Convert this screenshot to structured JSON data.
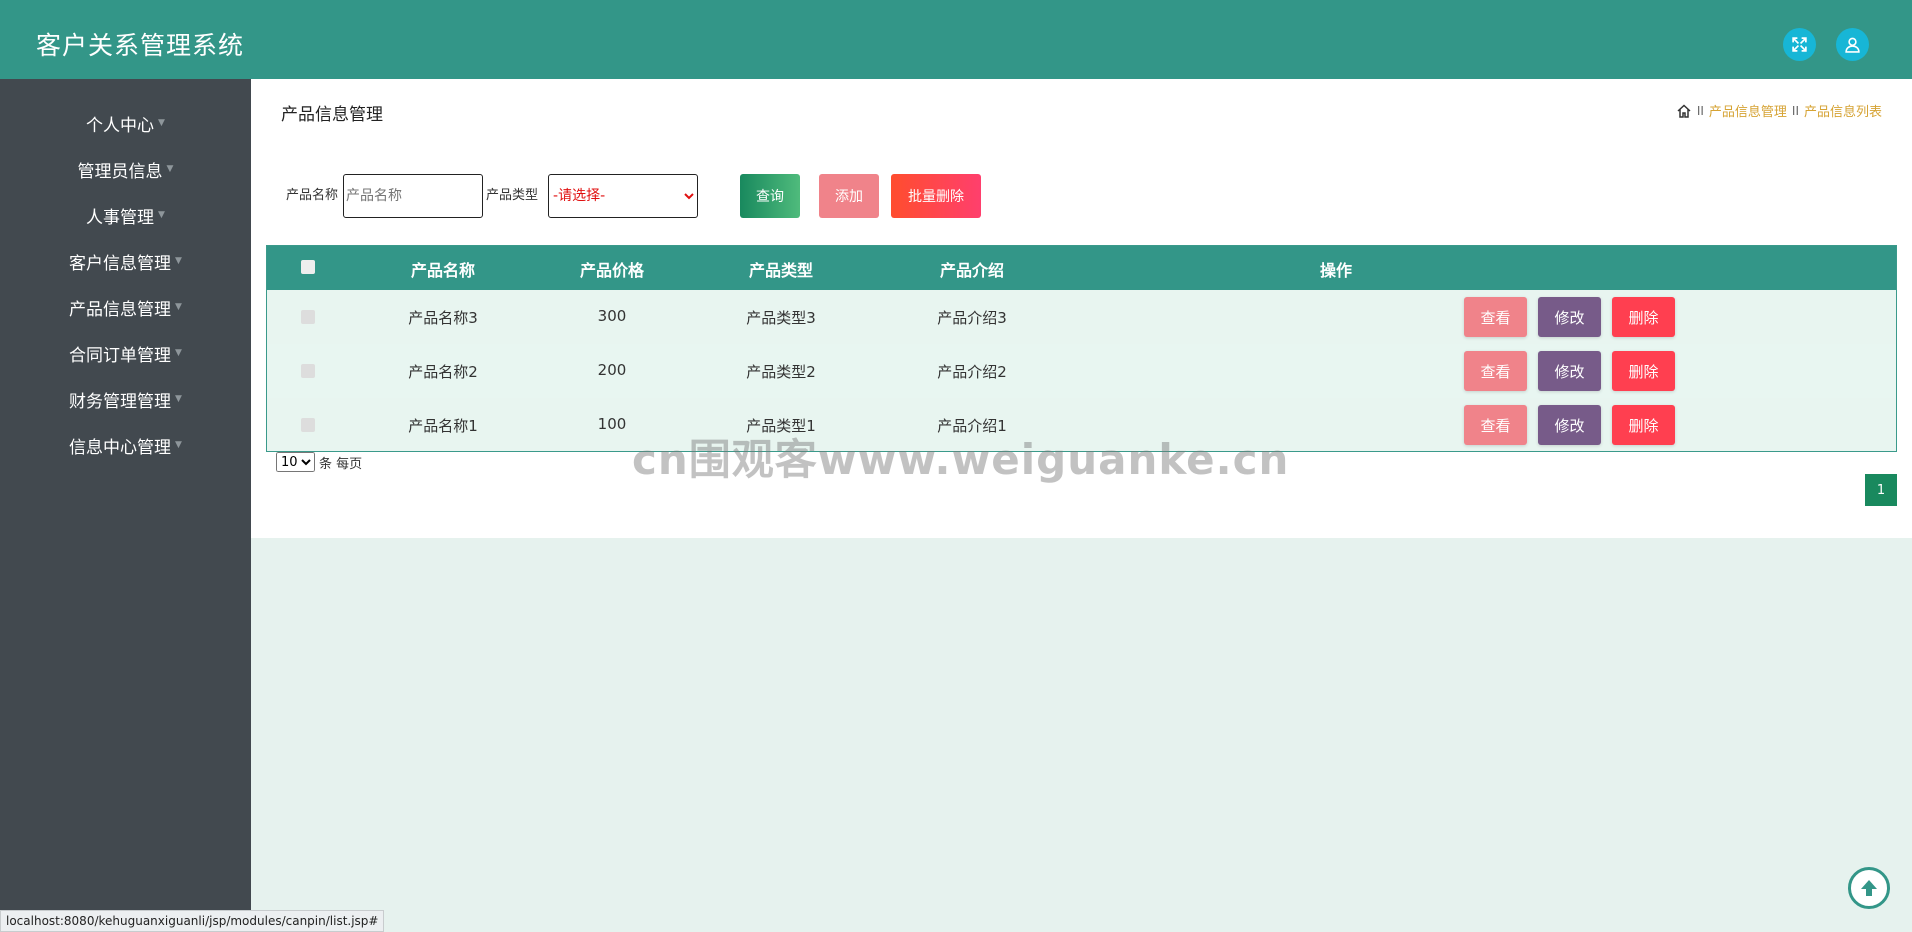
{
  "header": {
    "title": "客户关系管理系统",
    "fullscreen_icon": "fullscreen-icon",
    "user_icon": "user-icon"
  },
  "sidebar": {
    "items": [
      {
        "label": "个人中心"
      },
      {
        "label": "管理员信息"
      },
      {
        "label": "人事管理"
      },
      {
        "label": "客户信息管理"
      },
      {
        "label": "产品信息管理"
      },
      {
        "label": "合同订单管理"
      },
      {
        "label": "财务管理管理"
      },
      {
        "label": "信息中心管理"
      }
    ]
  },
  "main": {
    "page_title": "产品信息管理",
    "breadcrumb": {
      "sep": "II",
      "level1": "产品信息管理",
      "level2": "产品信息列表"
    },
    "search": {
      "name_label": "产品名称",
      "name_placeholder": "产品名称",
      "type_label": "产品类型",
      "type_selected": "-请选择-"
    },
    "buttons": {
      "query": "查询",
      "add": "添加",
      "bulk_delete": "批量删除"
    },
    "table": {
      "headers": [
        "产品名称",
        "产品价格",
        "产品类型",
        "产品介绍",
        "操作"
      ],
      "rows": [
        {
          "name": "产品名称3",
          "price": "300",
          "type": "产品类型3",
          "intro": "产品介绍3"
        },
        {
          "name": "产品名称2",
          "price": "200",
          "type": "产品类型2",
          "intro": "产品介绍2"
        },
        {
          "name": "产品名称1",
          "price": "100",
          "type": "产品类型1",
          "intro": "产品介绍1"
        }
      ],
      "actions": {
        "view": "查看",
        "edit": "修改",
        "delete": "删除"
      }
    },
    "pager": {
      "page_size": "10",
      "page_size_suffix": "条 每页",
      "current_page": "1"
    }
  },
  "watermark": "cn围观客www.weiguanke.cn",
  "statusbar": "localhost:8080/kehuguanxiguanli/jsp/modules/canpin/list.jsp#",
  "colors": {
    "header_bg": "#339688",
    "sidebar_bg": "#42494f",
    "breadcrumb_text": "#d6a334",
    "view_btn": "#f0838a",
    "edit_btn": "#775b89",
    "delete_btn": "#ff3f50"
  }
}
